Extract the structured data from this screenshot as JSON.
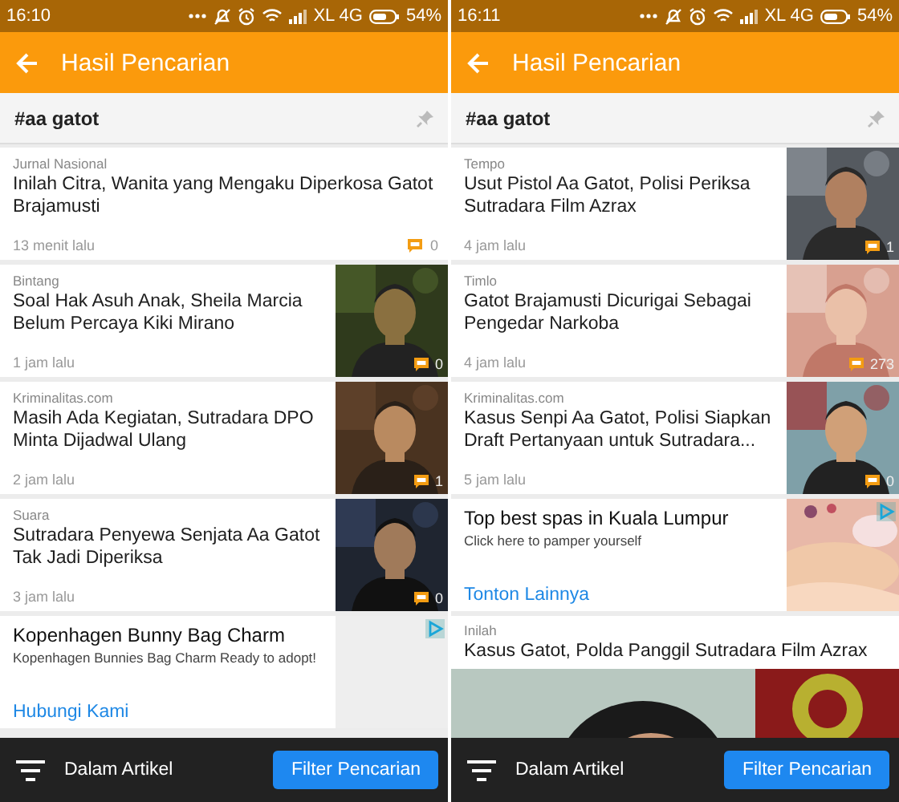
{
  "phones": [
    {
      "status_bar": {
        "time": "16:10",
        "carrier": "XL 4G",
        "battery": "54%"
      },
      "app_bar": {
        "title": "Hasil Pencarian"
      },
      "search": {
        "value": "#aa gatot"
      },
      "items": [
        {
          "kind": "article",
          "source": "Jurnal Nasional",
          "title": "Inilah Citra, Wanita yang Mengaku Diperkosa Gatot Brajamusti",
          "time": "13 menit lalu",
          "comments": "0",
          "picture": false
        },
        {
          "kind": "article",
          "source": "Bintang",
          "title": "Soal Hak Asuh Anak, Sheila Marcia Belum Percaya Kiki Mirano",
          "time": "1 jam lalu",
          "comments": "0",
          "picture": true
        },
        {
          "kind": "article",
          "source": "Kriminalitas.com",
          "title": "Masih Ada Kegiatan, Sutradara DPO Minta Dijadwal Ulang",
          "time": "2 jam lalu",
          "comments": "1",
          "picture": true
        },
        {
          "kind": "article",
          "source": "Suara",
          "title": "Sutradara Penyewa Senjata Aa Gatot Tak Jadi Diperiksa",
          "time": "3 jam lalu",
          "comments": "0",
          "picture": true
        },
        {
          "kind": "ad",
          "title": "Kopenhagen Bunny Bag Charm",
          "text": "Kopenhagen Bunnies Bag Charm Ready to adopt!",
          "link": "Hubungi Kami",
          "picture": false
        }
      ],
      "bottom_bar": {
        "label": "Dalam Artikel",
        "button": "Filter Pencarian"
      }
    },
    {
      "status_bar": {
        "time": "16:11",
        "carrier": "XL 4G",
        "battery": "54%"
      },
      "app_bar": {
        "title": "Hasil Pencarian"
      },
      "search": {
        "value": "#aa gatot"
      },
      "items": [
        {
          "kind": "article",
          "source": "Tempo",
          "title": "Usut Pistol Aa Gatot, Polisi Periksa Sutradara Film Azrax",
          "time": "4 jam lalu",
          "comments": "1",
          "picture": true
        },
        {
          "kind": "article",
          "source": "Timlo",
          "title": "Gatot Brajamusti Dicurigai Sebagai Pengedar Narkoba",
          "time": "4 jam lalu",
          "comments": "273",
          "picture": true
        },
        {
          "kind": "article",
          "source": "Kriminalitas.com",
          "title": "Kasus Senpi Aa Gatot, Polisi Siapkan Draft Pertanyaan untuk Sutradara...",
          "time": "5 jam lalu",
          "comments": "0",
          "picture": true
        },
        {
          "kind": "ad",
          "title": "Top best spas in Kuala Lumpur",
          "text": "Click here to pamper yourself",
          "link": "Tonton Lainnya",
          "picture": true
        },
        {
          "kind": "feature",
          "source": "Inilah",
          "title": "Kasus Gatot, Polda Panggil Sutradara Film Azrax"
        }
      ],
      "bottom_bar": {
        "label": "Dalam Artikel",
        "button": "Filter Pencarian"
      }
    }
  ]
}
